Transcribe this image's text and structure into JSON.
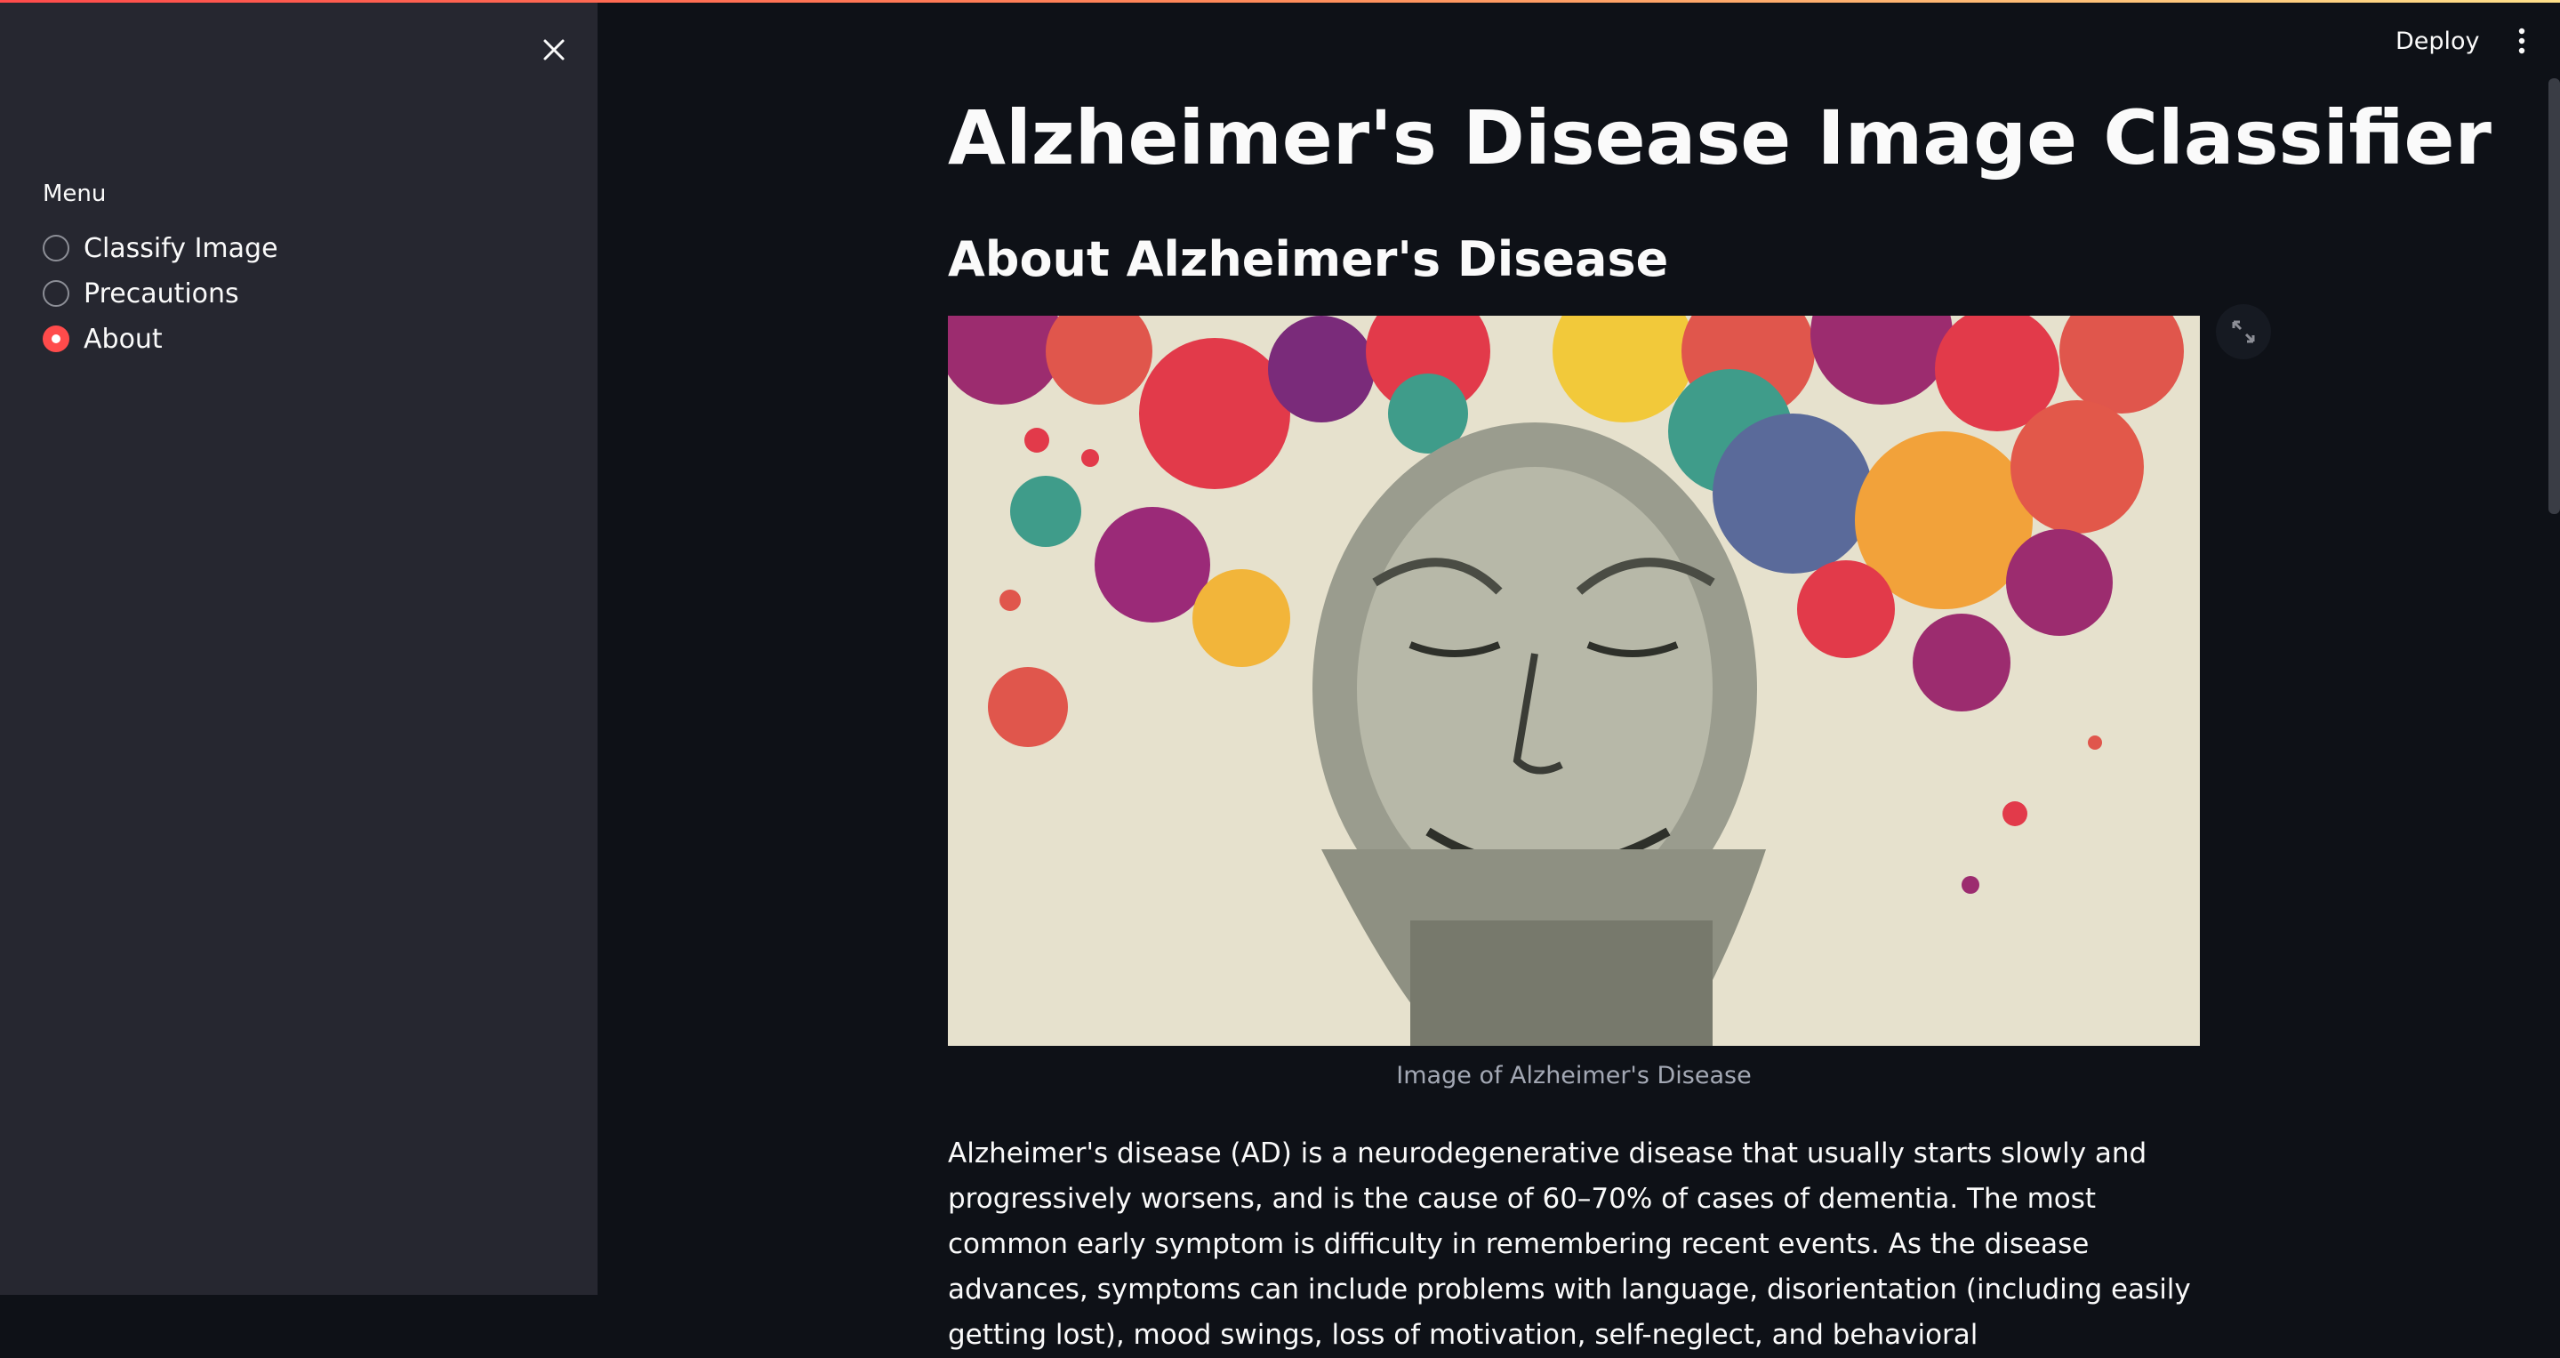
{
  "sidebar": {
    "close_icon": "close-icon",
    "menu_label": "Menu",
    "options": [
      {
        "label": "Classify Image",
        "selected": false
      },
      {
        "label": "Precautions",
        "selected": false
      },
      {
        "label": "About",
        "selected": true
      }
    ]
  },
  "header": {
    "deploy_label": "Deploy",
    "more_icon": "vertical-dots-icon"
  },
  "main": {
    "title": "Alzheimer's Disease Image Classifier",
    "subtitle": "About Alzheimer's Disease",
    "image": {
      "caption": "Image of Alzheimer's Disease",
      "fullscreen_icon": "fullscreen-icon"
    },
    "description": "Alzheimer's disease (AD) is a neurodegenerative disease that usually starts slowly and progressively worsens, and is the cause of 60–70% of cases of dementia. The most common early symptom is difficulty in remembering recent events. As the disease advances, symptoms can include problems with language, disorientation (including easily getting lost), mood swings, loss of motivation, self-neglect, and behavioral"
  },
  "colors": {
    "background": "#0e1117",
    "sidebar": "#262730",
    "accent": "#ff4b4b",
    "text": "#fafafa",
    "caption": "#a3a8b4"
  }
}
